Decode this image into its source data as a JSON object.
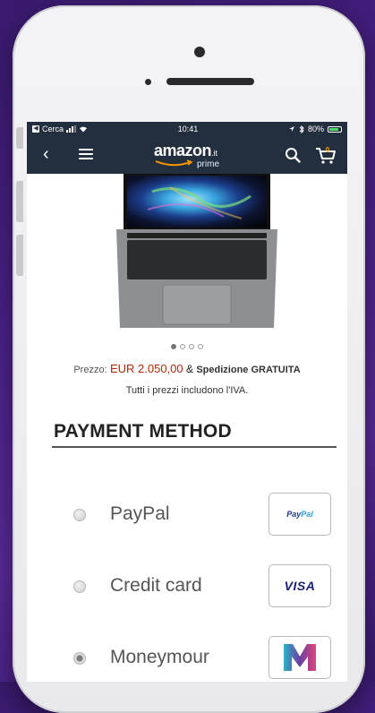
{
  "status_bar": {
    "carrier": "Cerca",
    "time": "10:41",
    "battery": "80%"
  },
  "navbar": {
    "logo_text": "amazon",
    "logo_tld": ".it",
    "logo_sub": "prime",
    "cart_count": "0"
  },
  "carousel": {
    "total": 4,
    "active_index": 0
  },
  "price": {
    "label": "Prezzo:",
    "value": "EUR 2.050,00",
    "ampersand": "&",
    "shipping": "Spedizione GRATUITA",
    "vat_note": "Tutti i prezzi includono l'IVA."
  },
  "payment": {
    "title": "PAYMENT METHOD",
    "options": [
      {
        "label": "PayPal",
        "logo_text_a": "Pay",
        "logo_text_b": "Pal",
        "selected": false
      },
      {
        "label": "Credit card",
        "logo_text": "VISA",
        "selected": false
      },
      {
        "label": "Moneymour",
        "logo_text": "M",
        "selected": true
      }
    ]
  },
  "colors": {
    "navbar": "#232f3e",
    "price": "#b12704",
    "background": "#4a2288",
    "moneymour_gradient": [
      "#2bb3c9",
      "#6b3fa0",
      "#e0457b"
    ]
  }
}
